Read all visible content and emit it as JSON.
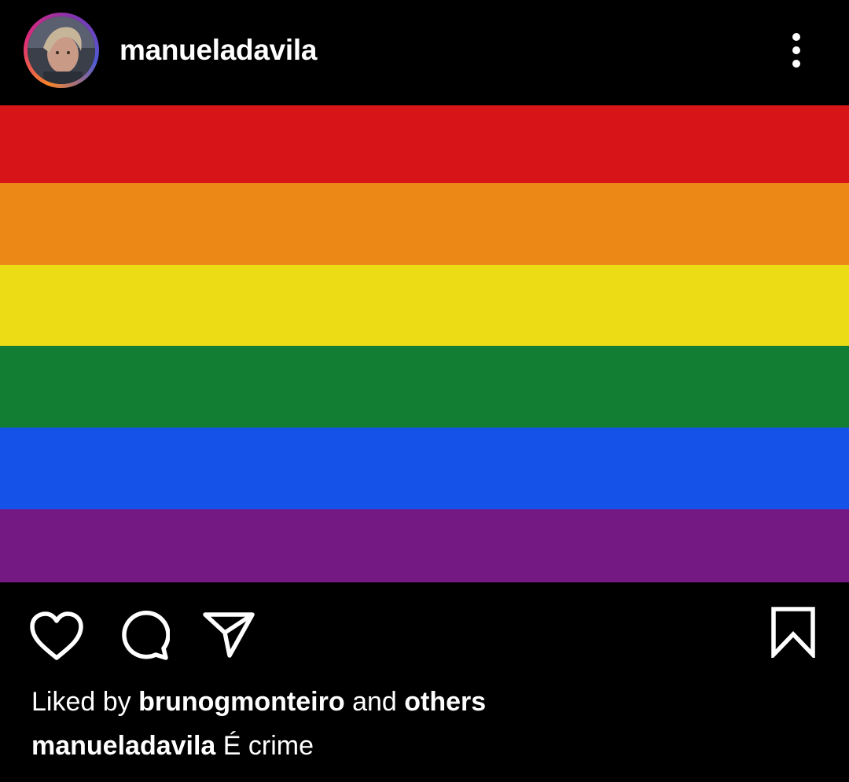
{
  "post": {
    "username": "manueladavila",
    "more_icon": "vertical-ellipsis-icon",
    "flag_colors": [
      "#d71518",
      "#ec8816",
      "#ecdc16",
      "#127e33",
      "#1553e8",
      "#741883"
    ],
    "actions": {
      "like_icon": "heart-icon",
      "comment_icon": "comment-bubble-icon",
      "share_icon": "paper-plane-icon",
      "save_icon": "bookmark-icon"
    },
    "likes": {
      "prefix": "Liked by",
      "user": "brunogmonteiro",
      "conjunction": "and",
      "suffix": "others"
    },
    "caption": {
      "username": "manueladavila",
      "text": "É crime"
    }
  }
}
